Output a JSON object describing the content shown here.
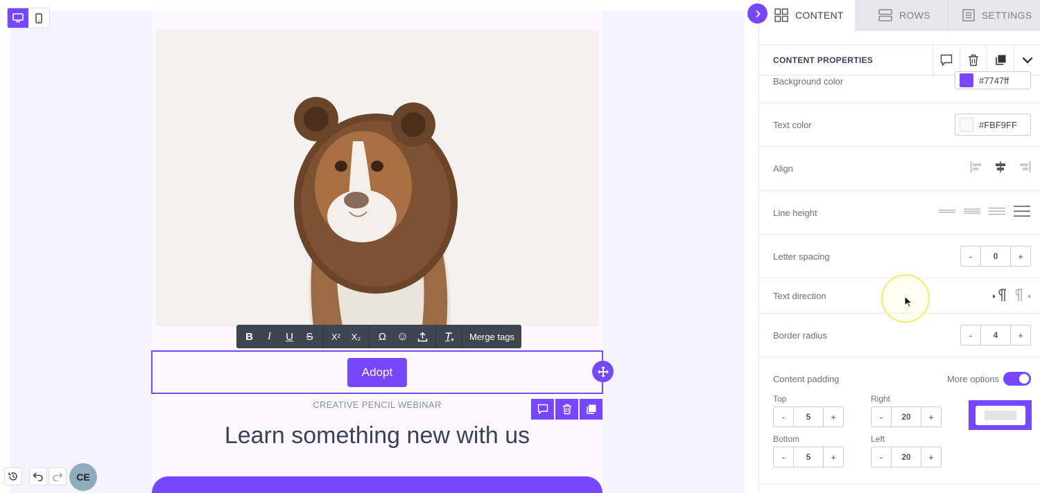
{
  "canvas": {
    "eyebrow": "CREATIVE PENCIL WEBINAR",
    "headline": "Learn something new with us",
    "button_label": "Adopt",
    "avatar_initials": "CE"
  },
  "toolbar": {
    "bold": "B",
    "italic": "I",
    "underline": "U",
    "strike": "S",
    "superscript": "X²",
    "subscript": "X₂",
    "special_char": "Ω",
    "emoji": "☺",
    "merge_tags": "Merge tags"
  },
  "sidebar": {
    "tabs": [
      {
        "label": "CONTENT",
        "icon": "grid-icon",
        "active": true
      },
      {
        "label": "ROWS",
        "icon": "rows-icon",
        "active": false
      },
      {
        "label": "SETTINGS",
        "icon": "settings-doc-icon",
        "active": false
      }
    ],
    "header_title": "CONTENT PROPERTIES",
    "background_color": {
      "label": "Background color",
      "value": "#7747ff"
    },
    "text_color": {
      "label": "Text color",
      "value": "#FBF9FF"
    },
    "align": {
      "label": "Align"
    },
    "line_height": {
      "label": "Line height"
    },
    "letter_spacing": {
      "label": "Letter spacing",
      "value": "0"
    },
    "text_direction": {
      "label": "Text direction"
    },
    "border_radius": {
      "label": "Border radius",
      "value": "4"
    },
    "content_padding": {
      "label": "Content padding",
      "more_options": "More options",
      "more_options_on": true,
      "top": {
        "label": "Top",
        "value": "5"
      },
      "right": {
        "label": "Right",
        "value": "20"
      },
      "bottom": {
        "label": "Bottom",
        "value": "5"
      },
      "left": {
        "label": "Left",
        "value": "20"
      }
    },
    "stepper_minus": "-",
    "stepper_plus": "+"
  },
  "colors": {
    "accent": "#7747ff",
    "toolbar_bg": "#3d464f",
    "text_light": "#FBF9FF"
  }
}
